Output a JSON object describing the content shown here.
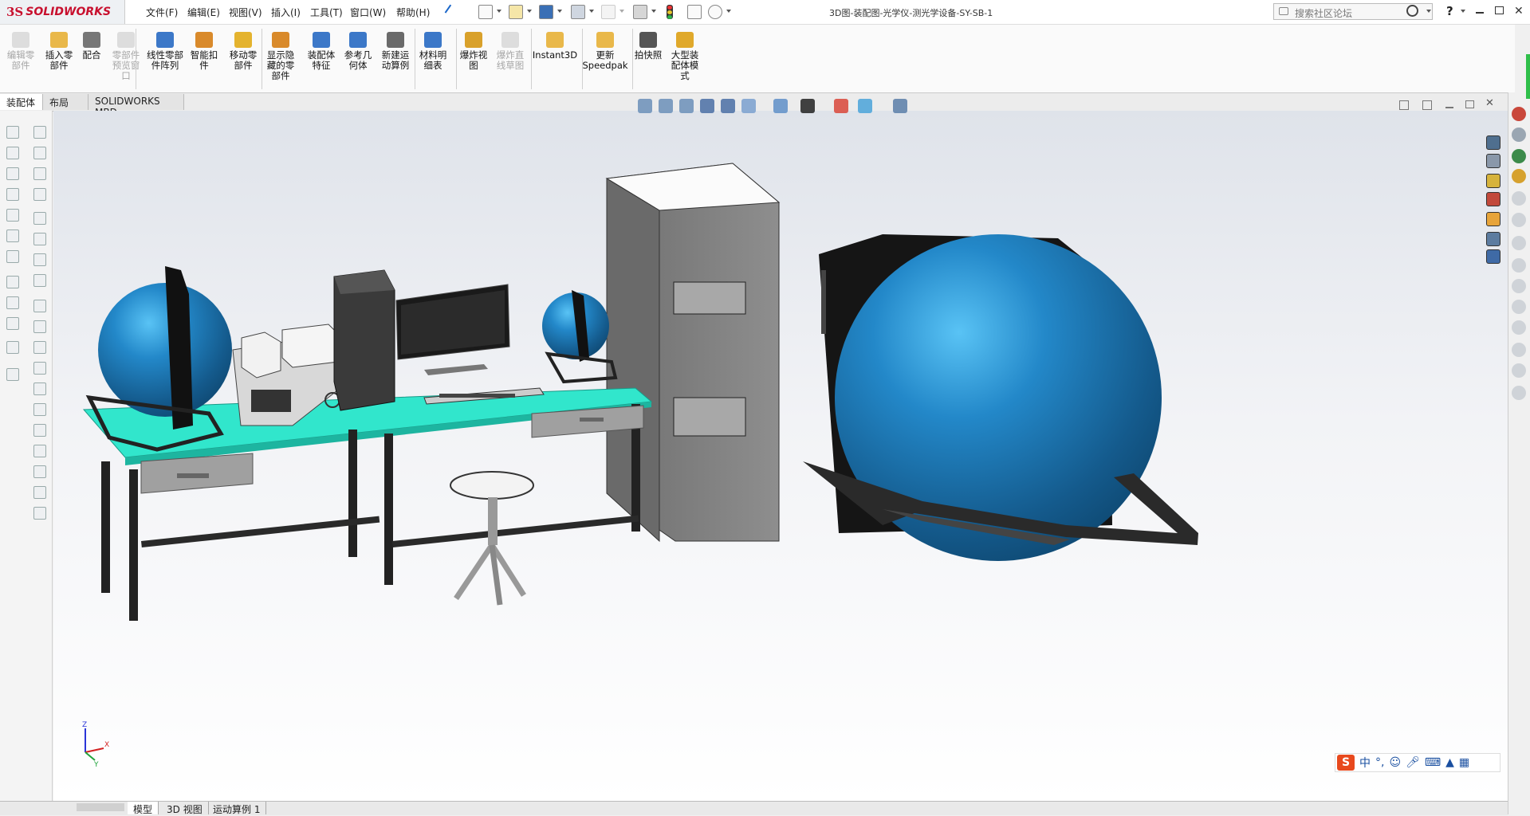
{
  "titlebar": {
    "logo_ds": "3S",
    "logo_text": "SOLIDWORKS",
    "menus": [
      "文件(F)",
      "编辑(E)",
      "视图(V)",
      "插入(I)",
      "工具(T)",
      "窗口(W)",
      "帮助(H)"
    ],
    "document_title": "3D图-装配图-光学仪-测光学设备-SY-SB-1",
    "search_placeholder": "搜索社区论坛",
    "help_label": "?"
  },
  "commands": [
    {
      "label": "编辑零\n部件",
      "enabled": false,
      "icon": "edit-component-icon"
    },
    {
      "label": "插入零\n部件",
      "enabled": true,
      "icon": "insert-component-icon"
    },
    {
      "label": "配合",
      "enabled": true,
      "icon": "mate-icon"
    },
    {
      "label": "零部件\n预览窗\n口",
      "enabled": false,
      "icon": "component-preview-icon"
    },
    {
      "label": "线性零部\n件阵列",
      "enabled": true,
      "icon": "linear-pattern-icon"
    },
    {
      "label": "智能扣\n件",
      "enabled": true,
      "icon": "smart-fasteners-icon"
    },
    {
      "label": "移动零\n部件",
      "enabled": true,
      "icon": "move-component-icon"
    },
    {
      "label": "显示隐\n藏的零\n部件",
      "enabled": true,
      "icon": "show-hidden-icon"
    },
    {
      "label": "装配体\n特征",
      "enabled": true,
      "icon": "assembly-features-icon"
    },
    {
      "label": "参考几\n何体",
      "enabled": true,
      "icon": "reference-geometry-icon"
    },
    {
      "label": "新建运\n动算例",
      "enabled": true,
      "icon": "motion-study-icon"
    },
    {
      "label": "材料明\n细表",
      "enabled": true,
      "icon": "bom-icon"
    },
    {
      "label": "爆炸视\n图",
      "enabled": true,
      "icon": "exploded-view-icon"
    },
    {
      "label": "爆炸直\n线草图",
      "enabled": false,
      "icon": "explode-line-sketch-icon"
    },
    {
      "label": "Instant3D",
      "enabled": true,
      "icon": "instant3d-icon"
    },
    {
      "label": "更新\nSpeedpak",
      "enabled": true,
      "icon": "speedpak-icon"
    },
    {
      "label": "拍快照",
      "enabled": true,
      "icon": "snapshot-icon"
    },
    {
      "label": "大型装\n配体模\n式",
      "enabled": true,
      "icon": "large-assembly-icon"
    }
  ],
  "tabs": [
    "装配体",
    "布局",
    "SOLIDWORKS MBD"
  ],
  "active_tab": "装配体",
  "bottom_tabs": [
    "模型",
    "3D 视图",
    "运动算例 1"
  ],
  "active_bottom_tab": "模型",
  "triad": {
    "x": "X",
    "y": "Y",
    "z": "Z"
  },
  "ime": {
    "logo": "S",
    "lang": "中",
    "punct": "°,"
  },
  "colors": {
    "accent_red": "#c8102e",
    "sphere_blue": "#1f84c4",
    "table_top": "#29e3c8",
    "cabinet_gray": "#8c8c8c"
  }
}
